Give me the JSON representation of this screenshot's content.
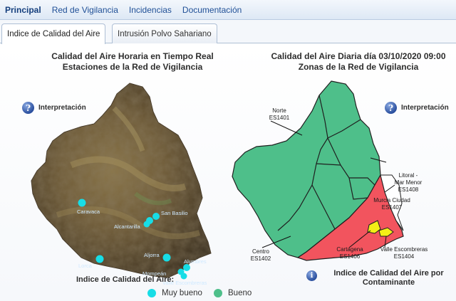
{
  "nav": {
    "items": [
      "Principal",
      "Red de Vigilancia",
      "Incidencias",
      "Documentación"
    ]
  },
  "tabs": [
    "Indice de Calidad del Aire",
    "Intrusión Polvo Sahariano"
  ],
  "left_panel": {
    "title_line1": "Calidad del Aire Horaria en Tiempo Real",
    "title_line2": "Estaciones de la Red de Vigilancia",
    "info_label": "Interpretación",
    "stations": [
      "Caravaca",
      "San Basilio",
      "Alcantarilla",
      "Lorca",
      "Aljorra",
      "Alumbres",
      "Mompeán",
      "Valle Escombreras"
    ],
    "legend_title": "Indice de Calidad del Aire:",
    "legend": [
      {
        "label": "Muy bueno",
        "color": "#17dde6"
      },
      {
        "label": "Bueno",
        "color": "#4ebf8a"
      }
    ]
  },
  "right_panel": {
    "title_line1": "Calidad del Aire Diaria día 03/10/2020 09:00",
    "title_line2": "Zonas de la Red de Vigilancia",
    "info_label": "Interpretación",
    "zones": [
      {
        "name": "Norte",
        "code": "ES1401"
      },
      {
        "name": "Murcia Ciudad",
        "code": "ES1407"
      },
      {
        "name": "Litoral -",
        "name2": "Mar Menor",
        "code": "ES1408"
      },
      {
        "name": "Centro",
        "code": "ES1402"
      },
      {
        "name": "Cartagena",
        "code": "ES1406"
      },
      {
        "name": "Valle Escombreras",
        "code": "ES1404"
      }
    ],
    "pollutant_line1": "Indice de Calidad del Aire por",
    "pollutant_line2": "Contaminante"
  },
  "colors": {
    "muy_bueno": "#17dde6",
    "bueno": "#4ebf8a",
    "zone_red": "#f2545e",
    "zone_yellow": "#f4ee16"
  }
}
